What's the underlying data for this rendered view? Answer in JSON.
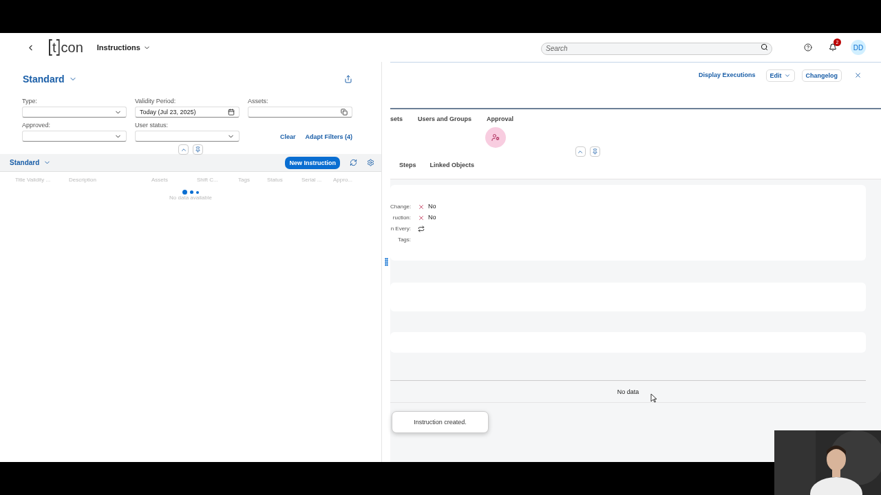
{
  "shell": {
    "logo": {
      "inner": "t",
      "outer": "con"
    },
    "app_title": "Instructions",
    "search": {
      "placeholder": "Search"
    },
    "notifications": "2",
    "avatar": "DD"
  },
  "list_report": {
    "variant": "Standard",
    "filters": [
      {
        "label": "Type:",
        "kind": "select"
      },
      {
        "label": "Validity Period:",
        "value": "Today (Jul 23, 2025)",
        "kind": "date"
      },
      {
        "label": "Assets:",
        "kind": "valuehelp"
      },
      {
        "label": "Approved:",
        "kind": "select"
      },
      {
        "label": "User status:",
        "kind": "select"
      }
    ],
    "filter_actions": [
      "Clear",
      "Adapt Filters (4)"
    ],
    "table": {
      "variant": "Standard",
      "new_button": "New Instruction",
      "columns": [
        "Title Validity ...",
        "Description",
        "Assets",
        "Shift C...",
        "Tags",
        "Status",
        "Serial ...",
        "Appro..."
      ],
      "busy": true,
      "empty_text": "No data available"
    }
  },
  "object_page": {
    "actions": [
      {
        "label": "Display Executions",
        "kind": "link"
      },
      {
        "label": "Edit",
        "kind": "menu"
      },
      {
        "label": "Changelog",
        "kind": "button"
      }
    ],
    "tabs": [
      "sets",
      "Users and Groups",
      "Approval"
    ],
    "sub_tabs": [
      "Steps",
      "Linked Objects"
    ],
    "fields": [
      {
        "label": "Change:",
        "kind": "bool",
        "value": "No"
      },
      {
        "label": "ruction:",
        "kind": "bool",
        "value": "No"
      },
      {
        "label": "n Every:",
        "kind": "repeat"
      },
      {
        "label": "Tags:",
        "kind": "empty"
      }
    ],
    "table_empty": "No data"
  },
  "toast": "Instruction created."
}
